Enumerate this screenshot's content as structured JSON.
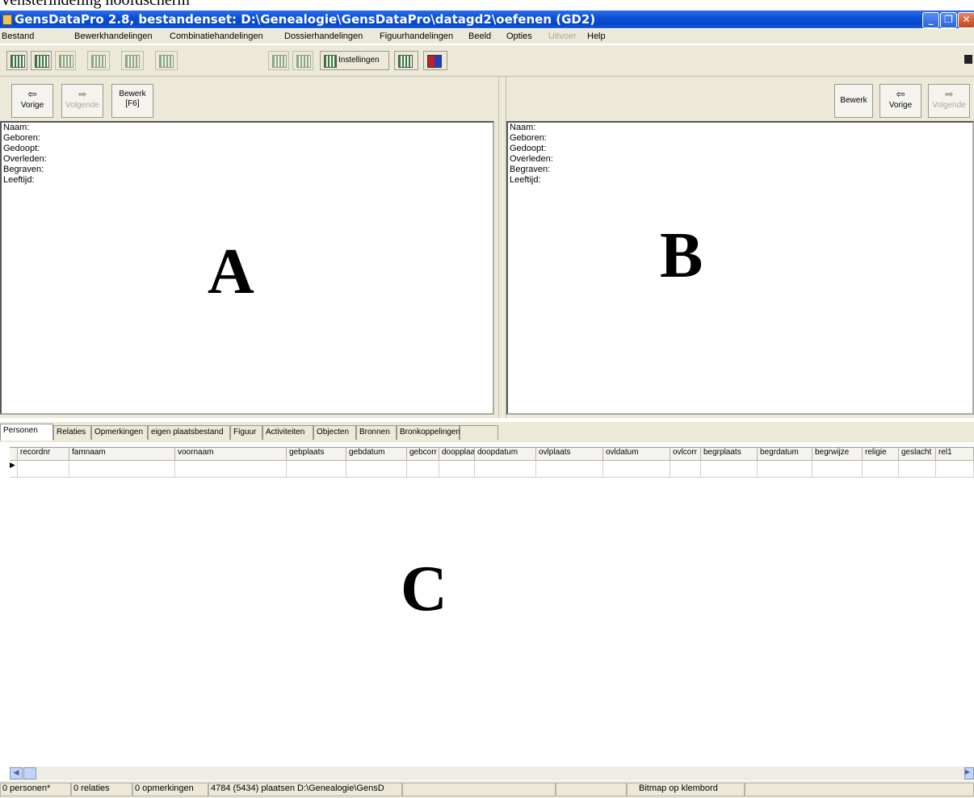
{
  "caption": "Vensterindeling hoofdscherm",
  "window": {
    "title": "GensDataPro 2.8, bestandenset: D:\\Genealogie\\GensDataPro\\datagd2\\oefenen (GD2)"
  },
  "menu": [
    {
      "label": "Bestand",
      "enabled": true
    },
    {
      "label": "Bewerkhandelingen",
      "enabled": true
    },
    {
      "label": "Combinatiehandelingen",
      "enabled": true
    },
    {
      "label": "Dossierhandelingen",
      "enabled": true
    },
    {
      "label": "Figuurhandelingen",
      "enabled": true
    },
    {
      "label": "Beeld",
      "enabled": true
    },
    {
      "label": "Opties",
      "enabled": true
    },
    {
      "label": "Uitvoer",
      "enabled": false
    },
    {
      "label": "Help",
      "enabled": true
    }
  ],
  "toolbar": {
    "instellingen_label": "Instellingen"
  },
  "panel_a": {
    "prev_label": "Vorige",
    "next_label": "Volgende",
    "edit_label": "Bewerk",
    "edit_shortcut": "[F6]",
    "fields": [
      "Naam:",
      "Geboren:",
      "Gedoopt:",
      "Overleden:",
      "Begraven:",
      "Leeftijd:"
    ],
    "marker": "A"
  },
  "panel_b": {
    "prev_label": "Vorige",
    "next_label": "Volgende",
    "edit_label": "Bewerk",
    "fields": [
      "Naam:",
      "Geboren:",
      "Gedoopt:",
      "Overleden:",
      "Begraven:",
      "Leeftijd:"
    ],
    "marker": "B"
  },
  "tabs": [
    "Personen",
    "Relaties",
    "Opmerkingen",
    "eigen plaatsbestand",
    "Figuur",
    "Activiteiten",
    "Objecten",
    "Bronnen",
    "Bronkoppelingen"
  ],
  "active_tab": "Personen",
  "grid": {
    "columns": [
      "recordnr",
      "famnaam",
      "voornaam",
      "gebplaats",
      "gebdatum",
      "gebcorr",
      "doopplaats",
      "doopdatum",
      "ovlplaats",
      "ovldatum",
      "ovlcorr",
      "begrplaats",
      "begrdatum",
      "begrwijze",
      "religie",
      "geslacht",
      "rel1"
    ],
    "marker": "C"
  },
  "status": {
    "personen": "0 personen*",
    "relaties": "0 relaties",
    "opmerkingen": "0 opmerkingen",
    "plaatsen": "4784 (5434) plaatsen D:\\Genealogie\\GensD",
    "clipboard": "Bitmap op klembord"
  }
}
